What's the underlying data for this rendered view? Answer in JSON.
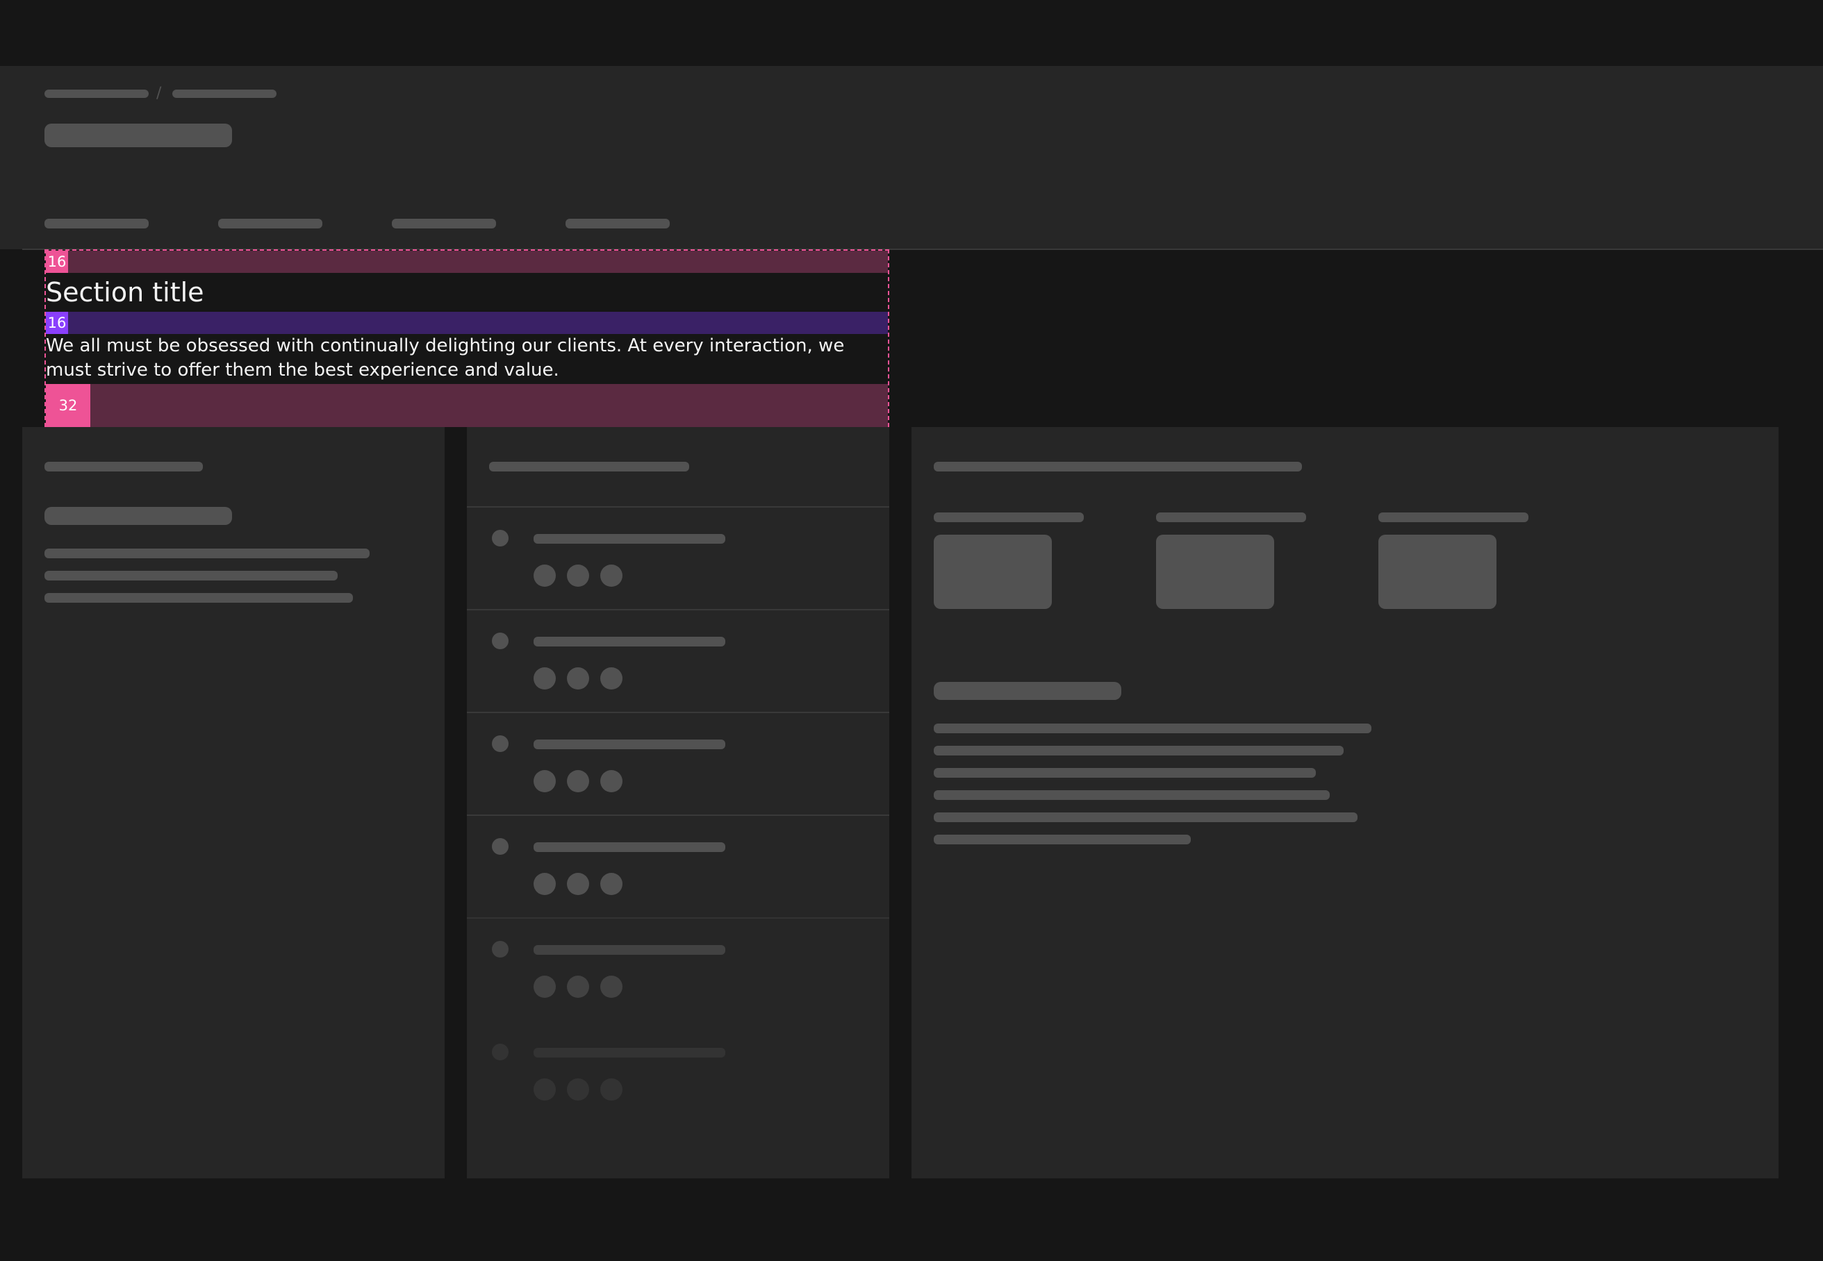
{
  "spec": {
    "top_spacing": "16",
    "title": "Section title",
    "middle_spacing": "16",
    "body": "We all must be obsessed with continually delighting our clients. At every interaction, we must strive to offer them the best experience and value.",
    "bottom_spacing": "32"
  },
  "breadcrumb": {
    "separator": "/"
  },
  "list": {
    "items_count_visible": 6
  }
}
